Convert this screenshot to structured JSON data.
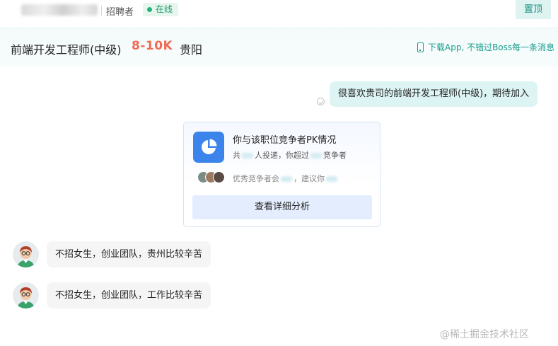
{
  "header": {
    "role": "招聘者",
    "online_status": "在线",
    "top_button": "置顶"
  },
  "job": {
    "title": "前端开发工程师(中级)",
    "salary": "8-10K",
    "city": "贵阳",
    "download_link": "下载App, 不错过Boss每一条消息"
  },
  "messages": {
    "greeting": "很喜欢贵司的前端开发工程师(中级)，期待加入",
    "reply1": "不招女生，创业团队，贵州比较辛苦",
    "reply2": "不招女生，创业团队，工作比较辛苦"
  },
  "pk_card": {
    "title": "你与该职位竞争者PK情况",
    "sub_part1": "共",
    "sub_part2": "人投递，你超过",
    "sub_part3": "竞争者",
    "hint_part1": "优秀竞争者会",
    "hint_part2": "，建议你",
    "button": "查看详细分析"
  },
  "watermark": "@稀土掘金技术社区",
  "colors": {
    "accent": "#1a9d8f",
    "salary": "#f06a54",
    "pk_icon": "#3a84ec"
  }
}
